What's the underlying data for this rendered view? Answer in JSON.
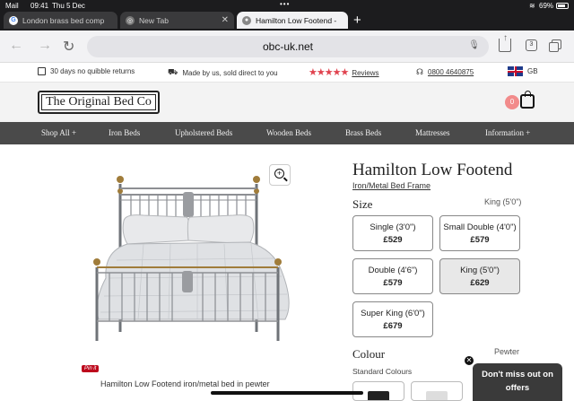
{
  "status_bar": {
    "carrier": "Mail",
    "time": "09:41",
    "date": "Thu 5 Dec",
    "battery": "69%"
  },
  "tabs": [
    {
      "label": "London brass bed comp",
      "favicon": "G",
      "active": false
    },
    {
      "label": "New Tab",
      "active": false
    },
    {
      "label": "Hamilton Low Footend -",
      "active": true
    }
  ],
  "browser": {
    "url": "obc-uk.net",
    "tab_count": "3"
  },
  "utility_bar": {
    "returns": "30 days no quibble returns",
    "direct": "Made by us, sold direct to you",
    "reviews": "Reviews",
    "phone": "0800 4640875",
    "region": "GB"
  },
  "header": {
    "logo": "The Original Bed Co",
    "basket_count": "0"
  },
  "nav": [
    "Shop All +",
    "Iron Beds",
    "Upholstered Beds",
    "Wooden Beds",
    "Brass Beds",
    "Mattresses",
    "Information +"
  ],
  "product": {
    "title": "Hamilton Low Footend",
    "category": "Iron/Metal Bed Frame",
    "size_label": "Size",
    "selected_size": "King (5'0\")",
    "sizes": [
      {
        "name": "Single (3'0\")",
        "price": "£529"
      },
      {
        "name": "Small Double (4'0\")",
        "price": "£579"
      },
      {
        "name": "Double (4'6\")",
        "price": "£579"
      },
      {
        "name": "King (5'0\")",
        "price": "£629"
      },
      {
        "name": "Super King (6'0\")",
        "price": "£679"
      }
    ],
    "colour_label": "Colour",
    "selected_colour": "Pewter",
    "standard_colours": "Standard Colours",
    "image_caption": "Hamilton Low Footend iron/metal bed in pewter",
    "pinit": "Pin it"
  },
  "popup": {
    "line1": "Don't miss out on",
    "line2": "offers"
  },
  "colors": {
    "nav_bg": "#4a4a4a",
    "star": "#e0434f",
    "basket_badge": "#f28b8b"
  }
}
